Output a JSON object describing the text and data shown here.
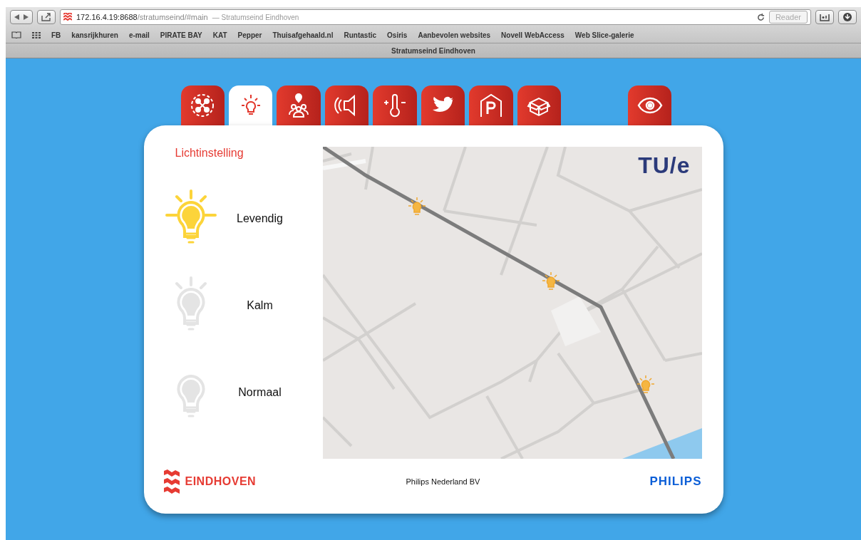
{
  "browser": {
    "address": {
      "host": "172.16.4.19:8688",
      "path": "/stratumseind/#main",
      "title": "— Stratumseind Eindhoven"
    },
    "reader": "Reader",
    "bookmarks": [
      "FB",
      "kansrijkhuren",
      "e-mail",
      "PIRATE BAY",
      "KAT",
      "Pepper",
      "Thuisafgehaald.nl",
      "Runtastic",
      "Osiris",
      "Aanbevolen websites",
      "Novell WebAccess",
      "Web Slice-galerie"
    ],
    "tab_title": "Stratumseind Eindhoven"
  },
  "tabs": [
    {
      "kind": "network",
      "selected": false
    },
    {
      "kind": "bulb",
      "selected": true
    },
    {
      "kind": "people",
      "selected": false
    },
    {
      "kind": "speaker",
      "selected": false
    },
    {
      "kind": "thermometer",
      "selected": false
    },
    {
      "kind": "bird",
      "selected": false
    },
    {
      "kind": "parking",
      "selected": false
    },
    {
      "kind": "box",
      "selected": false
    },
    {
      "kind": "eye",
      "selected": false
    }
  ],
  "panel": {
    "heading": "Lichtinstelling",
    "settings": [
      {
        "label": "Levendig",
        "kind": "bright",
        "selected": true
      },
      {
        "label": "Kalm",
        "kind": "soft",
        "selected": false
      },
      {
        "label": "Normaal",
        "kind": "plain",
        "selected": false
      }
    ],
    "map": {
      "logo": "TU/e"
    },
    "footer": {
      "city": "EINDHOVEN",
      "credit": "Philips Nederland BV",
      "brand": "PHILIPS"
    }
  }
}
